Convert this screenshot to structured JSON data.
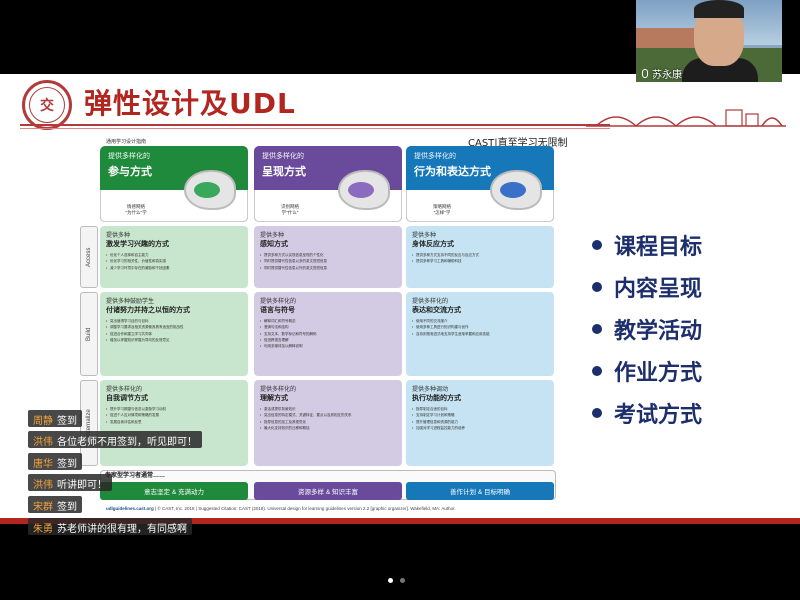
{
  "slide": {
    "title": "弹性设计及UDL",
    "logo_text": "交",
    "cast_title": "CAST|直至学习无限制",
    "bullets": [
      "课程目标",
      "内容呈现",
      "教学活动",
      "作业方式",
      "考试方式"
    ]
  },
  "udl": {
    "subtitle": "通用学习设计指南",
    "columns": [
      {
        "small": "提供多样化的",
        "big": "参与方式",
        "network": "情感网络\n\"为什么\"学",
        "color": "#1f8a3b",
        "lobe": "#3aa85a"
      },
      {
        "small": "提供多样化的",
        "big": "呈现方式",
        "network": "识别网络\n学\"什么\"",
        "color": "#6a4b9b",
        "lobe": "#8a6bc0"
      },
      {
        "small": "提供多样化的",
        "big": "行为和表达方式",
        "network": "策略网络\n\"怎样\"学",
        "color": "#1677b9",
        "lobe": "#3a70c8"
      }
    ],
    "rows": [
      "Access",
      "Build",
      "Internalize"
    ],
    "cells": [
      [
        {
          "small": "提供多种",
          "big": "激发学习兴趣的方式",
          "items": [
            "优化个人选择和自主能力",
            "优化学习的相关性、价值性和真实感",
            "减少学习环境中存在的威胁和干扰因素"
          ]
        },
        {
          "small": "提供多种",
          "big": "感知方式",
          "items": [
            "提供多种方式以实现信息呈现的个性化",
            "同时提供替代性信息以多的英文视觉信息",
            "同时提供替代性信息以外的英文视觉信息"
          ]
        },
        {
          "small": "提供多种",
          "big": "身体反应方式",
          "items": [
            "提供多种方式支持不同的反应与反应方式",
            "提供多种学习工具和辅助科技"
          ]
        }
      ],
      [
        {
          "small": "提供多种鼓励学生",
          "big": "付诸努力并持之以恒的方式",
          "items": [
            "突出值得学习目的与目标",
            "调整学习要求及相关资源使其具有适宜的挑战性",
            "促进合作和建立学习共同体",
            "增加以掌握知识掌握为导向的反馈意见"
          ]
        },
        {
          "small": "提供多样化的",
          "big": "语言与符号",
          "items": [
            "解释词汇和符号概念",
            "澄清句法和结构",
            "支持文本、数学标记和符号的解码",
            "促进跨语言理解",
            "利用多媒体加以解释说明"
          ]
        },
        {
          "small": "提供多样化的",
          "big": "表达和交流方式",
          "items": [
            "使用不同的交流媒介",
            "使用多种工具进行知识构建与创作",
            "血持刻按渐进式地支持学生逐渐掌握和应用技能"
          ]
        }
      ],
      [
        {
          "small": "提供多样化的",
          "big": "自我调节方式",
          "items": [
            "提升学习期望与信念以激励学习动机",
            "促进个人应对情境和策略的发展",
            "发展自我评估和反思"
          ]
        },
        {
          "small": "提供多样化的",
          "big": "理解方式",
          "items": [
            "激活或提供背景知识",
            "突出信息的特定模式、关键特征、要点以及其相互的关系",
            "指导信息的加工及其视觉化",
            "最大化支持知识的迁移和概括"
          ]
        },
        {
          "small": "提供多种调动",
          "big": "执行功能的方式",
          "items": [
            "指导制定合适的目标",
            "支持制定学习计划和策略",
            "提升管理信息和资源的能力",
            "加强对学习进程监控能力的培养"
          ]
        }
      ]
    ],
    "expert_label": "专家型学习者通常……",
    "goals": [
      "意志坚定 & 充满动力",
      "资源多样 & 知识丰富",
      "善作计划 & 目标明确"
    ],
    "footer_site": "udlguidelines.cast.org",
    "footer_text": " | © CAST, Inc. 2018 | Suggested Citation: CAST (2018). Universal design for learning guidelines version 2.2 [graphic organizer]. Wakefield, MA: Author."
  },
  "video": {
    "name": "苏永康"
  },
  "chat": [
    {
      "name": "周静",
      "text": "签到"
    },
    {
      "name": "洪伟",
      "text": "各位老师不用签到，听见即可！"
    },
    {
      "name": "唐华",
      "text": "签到"
    },
    {
      "name": "洪伟",
      "text": "听讲即可！"
    },
    {
      "name": "宋群",
      "text": "签到"
    },
    {
      "name": "朱勇",
      "text": "苏老师讲的很有理，有同感啊"
    }
  ]
}
